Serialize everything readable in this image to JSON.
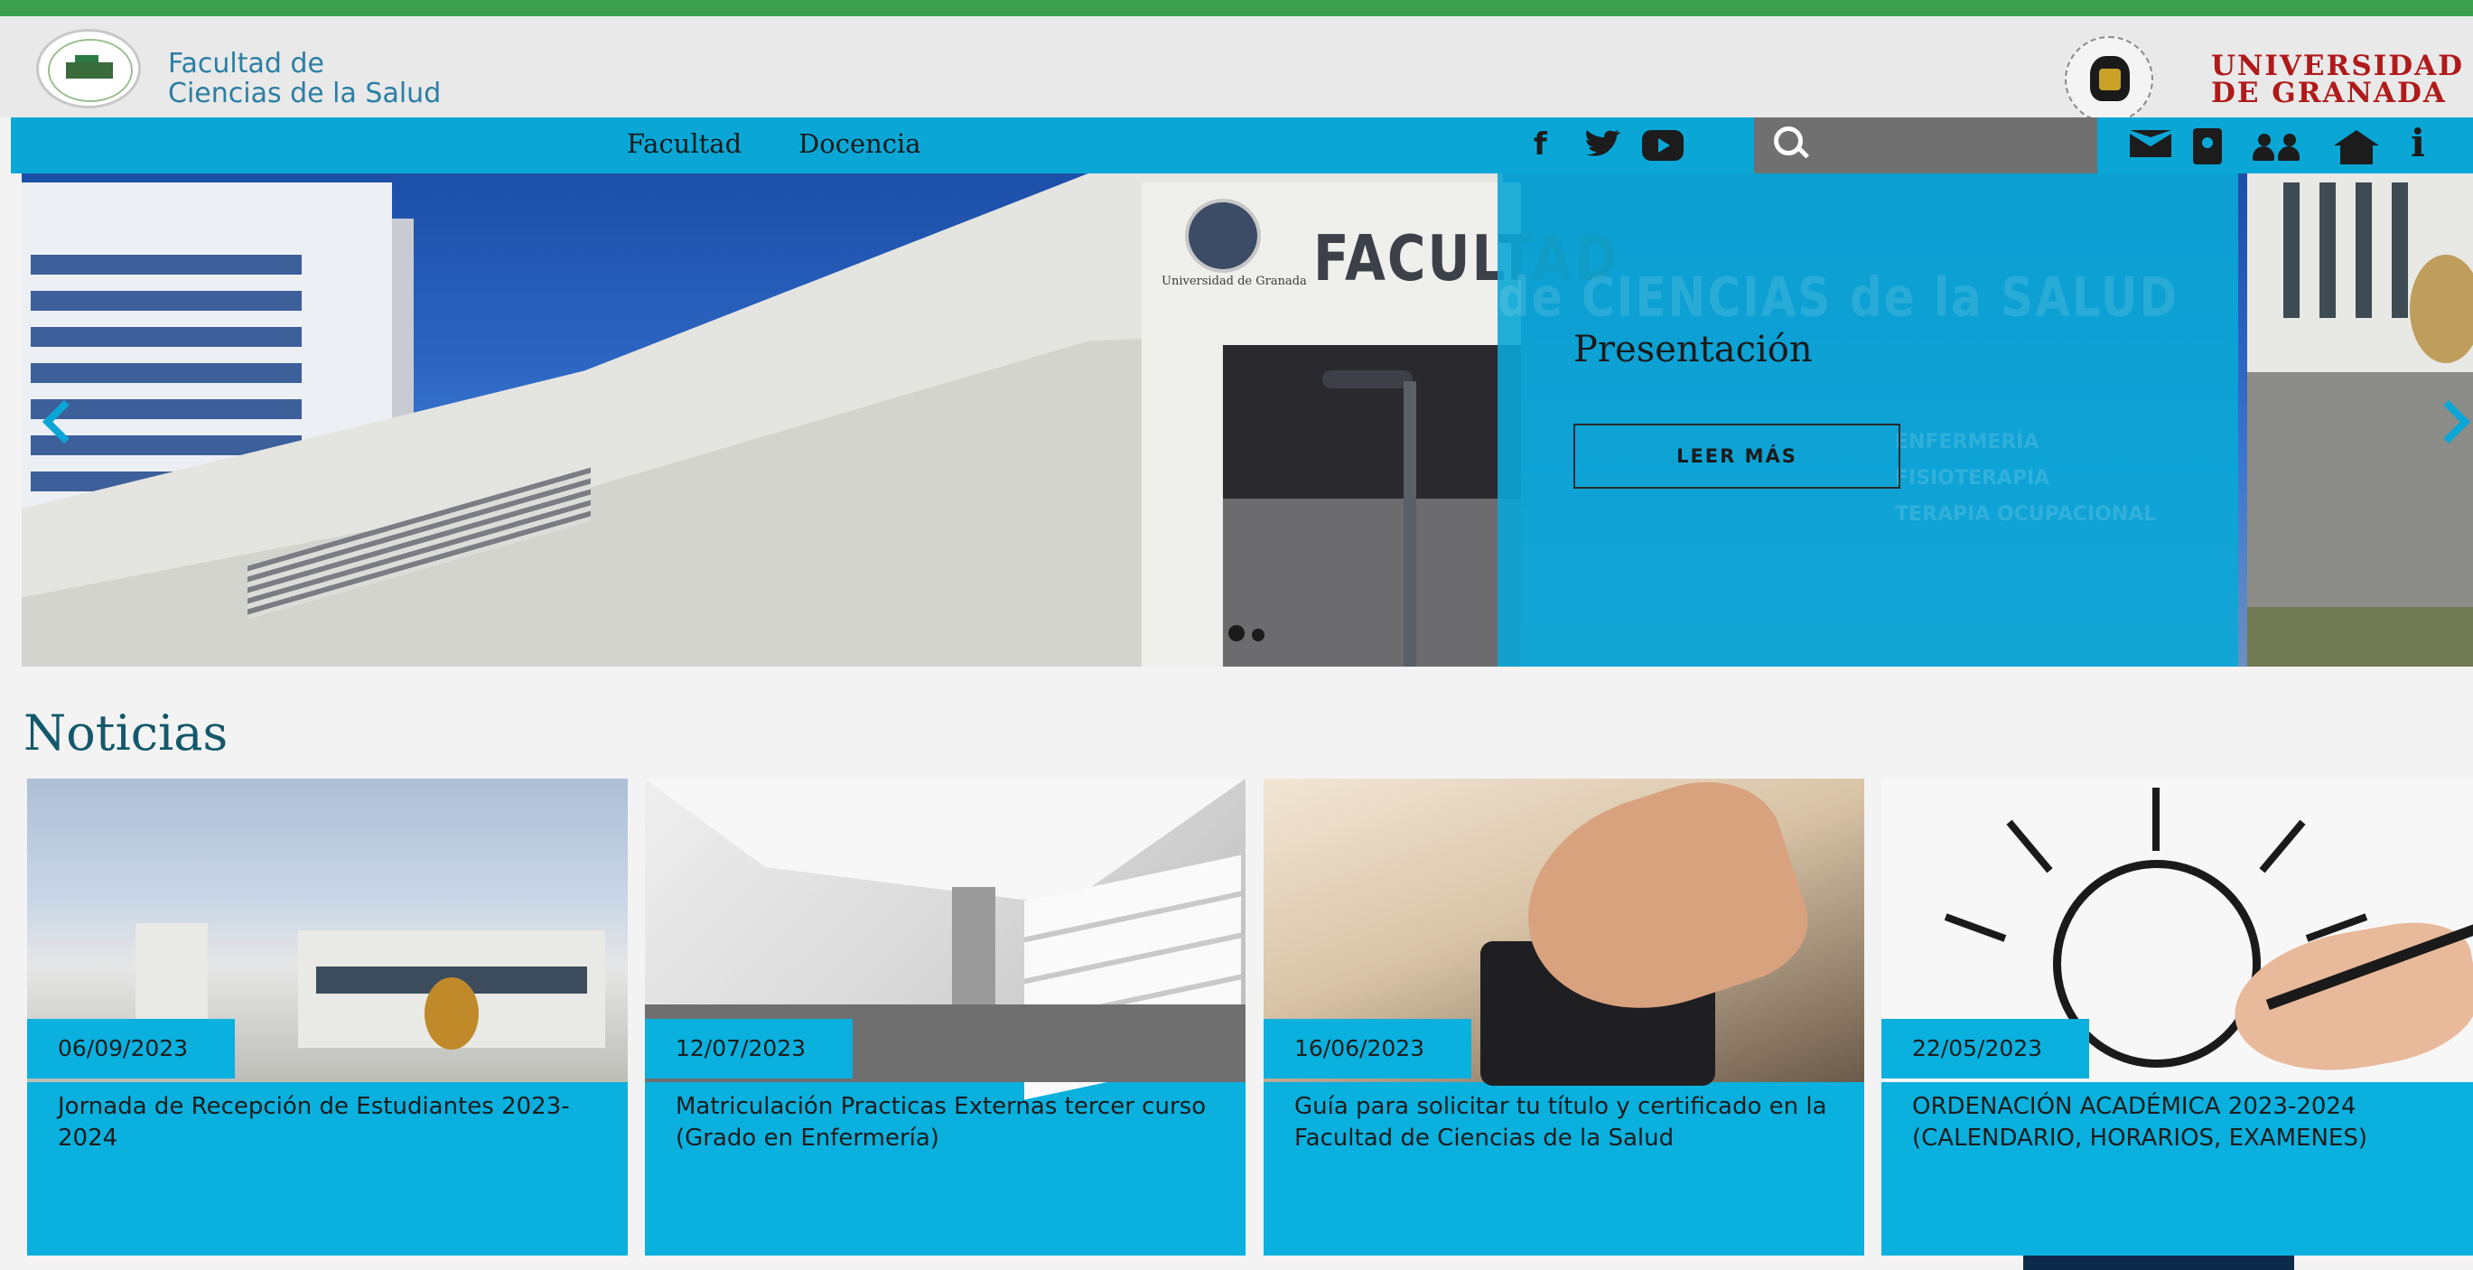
{
  "header": {
    "faculty_name_line1": "Facultad de",
    "faculty_name_line2": "Ciencias de la Salud",
    "university_line1": "UNIVERSIDAD",
    "university_line2": "DE GRANADA"
  },
  "nav": {
    "items": [
      "Facultad",
      "Docencia"
    ],
    "social": {
      "facebook": "f",
      "twitter": "🐦",
      "youtube": "▶"
    },
    "search_placeholder": "",
    "right_icons": [
      "mail-icon",
      "directory-icon",
      "users-icon",
      "home-icon",
      "info-icon"
    ],
    "info_glyph": "i"
  },
  "hero": {
    "slide_title": "Presentación",
    "button_label": "LEER MÁS",
    "building_sign": "FACULTAD",
    "university_small": "Universidad de Granada",
    "overlay_sign": "de CIENCIAS de la SALUD",
    "overlay_sign2": "ENFERMERÍA\nFISIOTERAPIA\nTERAPIA OCUPACIONAL",
    "dots": 2,
    "active_dot": 0
  },
  "news": {
    "title": "Noticias",
    "items": [
      {
        "date": "06/09/2023",
        "title": "Jornada de Recepción de Estudiantes 2023-2024"
      },
      {
        "date": "12/07/2023",
        "title": "Matriculación Practicas Externas tercer curso (Grado en Enfermería)"
      },
      {
        "date": "16/06/2023",
        "title": "Guía para solicitar tu título y certificado en la Facultad de Ciencias de la Salud"
      },
      {
        "date": "22/05/2023",
        "title": "ORDENACIÓN ACADÉMICA 2023-2024 (CALENDARIO, HORARIOS, EXAMENES)"
      }
    ]
  },
  "colors": {
    "accent": "#0aa7d6",
    "top_line": "#3aa04e",
    "news_heading": "#14586b",
    "university_red": "#b01a1a"
  }
}
